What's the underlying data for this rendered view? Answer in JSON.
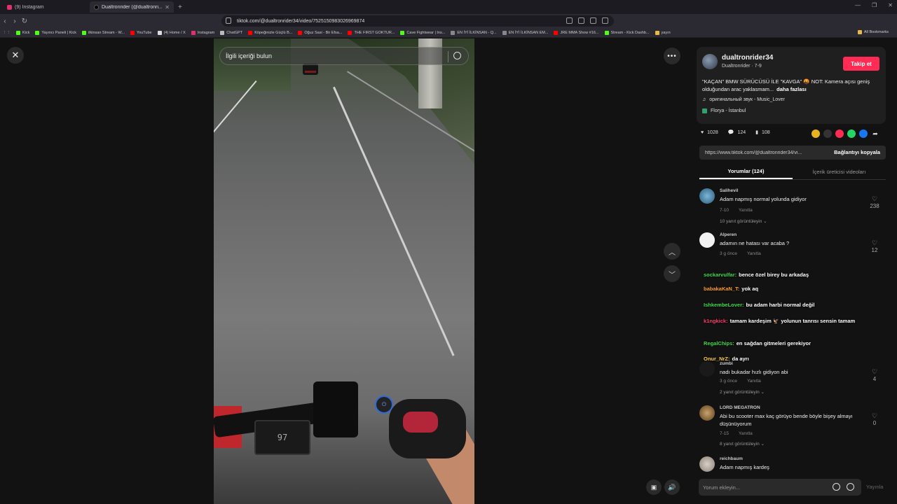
{
  "browser": {
    "tabs": [
      {
        "label": "(9) Instagram",
        "active": false
      },
      {
        "label": "Dualtronrider (@dualtronri...",
        "active": true
      }
    ],
    "url": "tiktok.com/@dualtronrider34/video/7525150983026969874",
    "bookmarks": [
      "Kick",
      "Yayıncı Paneli | Kick",
      "ilkinsan Stream - W...",
      "YouTube",
      "(4) Home / X",
      "Instagram",
      "ChatGPT",
      "Köpeğinizle Güçlü B...",
      "Oğuz Sasi - Bir Efsa...",
      "THE FIRST GOKTUR...",
      "Cave Fightwear | Ins...",
      "EN İYİ İLKİNSAN - Q...",
      "EN İYİ İLKİNSAN EM...",
      "JRE MMA Show #16...",
      "Stream - Kick Dashb...",
      "yayın"
    ],
    "all_bookmarks": "All Bookmarks"
  },
  "video": {
    "search_placeholder": "İlgili içeriği bulun",
    "speed_display": "97"
  },
  "post": {
    "username": "dualtronrider34",
    "subtitle": "Dualtronrider · 7-9",
    "follow_label": "Takip et",
    "description": "\"KAÇAN\" BMW SÜRÜCÜSÜ İLE \"KAVGA\" 🤬 NOT: Kamera açısı geniş olduğundan arac yaklasmam...",
    "more_label": "daha fazlası",
    "music": "оригинальный звук - Music_Lover",
    "location": "Florya - İstanbul",
    "likes": "1028",
    "comments_count": "124",
    "saves": "108",
    "link": "https://www.tiktok.com/@dualtronrider34/vi...",
    "copy_link_label": "Bağlantıyı kopyala"
  },
  "tabs": {
    "comments": "Yorumlar (124)",
    "creator_videos": "İçerik üreticisi videoları"
  },
  "comments": [
    {
      "name": "Salihevil",
      "text": "Adam napmış normal yolunda gidiyor",
      "date": "7-10",
      "reply": "Yanıtla",
      "likes": "238",
      "replies": "10 yanıt görüntüleyin"
    },
    {
      "name": "Alperen",
      "text": "adamın ne hatası var acaba ?",
      "date": "3 g önce",
      "reply": "Yanıtla",
      "likes": "12",
      "replies": ""
    },
    {
      "name": "zumbi",
      "text": "nadı bukadar hızlı gidiyon abi",
      "date": "3 g önce",
      "reply": "Yanıtla",
      "likes": "4",
      "replies": "2 yanıt görüntüleyin"
    },
    {
      "name": "LORD MEGATRON",
      "text": "Abi bu scooter max kaç görüyo bende böyle bişey almayı düşünüyorum",
      "date": "7-15",
      "reply": "Yanıtla",
      "likes": "0",
      "replies": "8 yanıt görüntüleyin"
    },
    {
      "name": "reichbaum",
      "text": "Adam napmış kardeş",
      "date": "",
      "reply": "",
      "likes": "",
      "replies": ""
    }
  ],
  "chat": [
    {
      "user": "sockarvulfar:",
      "message": "bence özel birey bu arkadaş",
      "color": "#3ddc4b"
    },
    {
      "user": "babakaKaN_T:",
      "message": "yok aq",
      "color": "#ff9f1a"
    },
    {
      "user": "IshkembeLover:",
      "message": "bu adam harbi normal değil",
      "color": "#3ddc4b"
    },
    {
      "user": "k1ngkick:",
      "message": "tamam kardeşim 🦅 yolunun tanrısı sensin tamam",
      "color": "#ff3b6b"
    },
    {
      "user": "RegalChips:",
      "message": "en sağdan gitmeleri gerekiyor",
      "color": "#3ddc4b"
    },
    {
      "user": "Onur_NrZ:",
      "message": "da ayrı",
      "color": "#ffcc33"
    }
  ],
  "composer": {
    "placeholder": "Yorum ekleyin...",
    "post_label": "Yayınla"
  }
}
